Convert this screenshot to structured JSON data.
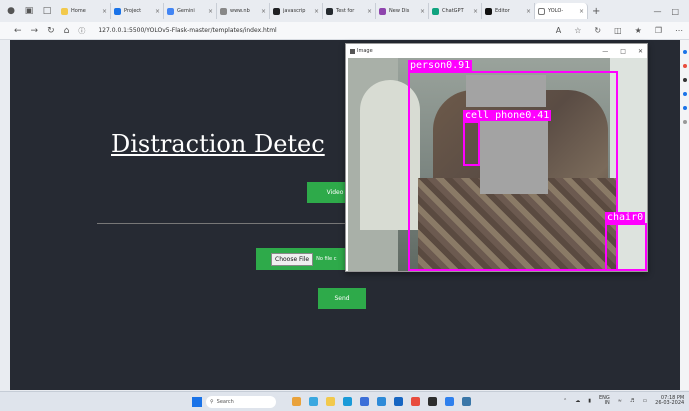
{
  "browser": {
    "tabs": [
      {
        "label": "Home",
        "color": "#f2c94c"
      },
      {
        "label": "Project",
        "color": "#1a73e8"
      },
      {
        "label": "Gemini",
        "color": "#4285f4"
      },
      {
        "label": "www.nb",
        "color": "#888888"
      },
      {
        "label": "javascrip",
        "color": "#202124"
      },
      {
        "label": "Test for",
        "color": "#24292e"
      },
      {
        "label": "New Dis",
        "color": "#8e44ad"
      },
      {
        "label": "ChatGPT",
        "color": "#10a37f"
      },
      {
        "label": "Editor",
        "color": "#111111"
      },
      {
        "label": "YOLO-",
        "color": "#ffffff"
      }
    ],
    "new_tab": "+",
    "url": "127.0.0.1:5500/YOLOv5-Flask-master/templates/index.html"
  },
  "page": {
    "title": "Distraction Detec",
    "video_button": "Video",
    "choose_file_button": "Choose File",
    "no_file_text": "No file c",
    "send_button": "Send"
  },
  "cv_window": {
    "title": "Image",
    "detections": [
      {
        "label": "person0.91"
      },
      {
        "label": "cell phone0.41"
      },
      {
        "label": "chair0"
      }
    ]
  },
  "taskbar": {
    "search_placeholder": "Search",
    "lang_top": "ENG",
    "lang_bottom": "IN",
    "time": "07:18 PM",
    "date": "26-03-2024"
  },
  "colors": {
    "accent": "#2eaa4a",
    "page_bg": "#262a33",
    "bbox": "#ff00ff"
  }
}
